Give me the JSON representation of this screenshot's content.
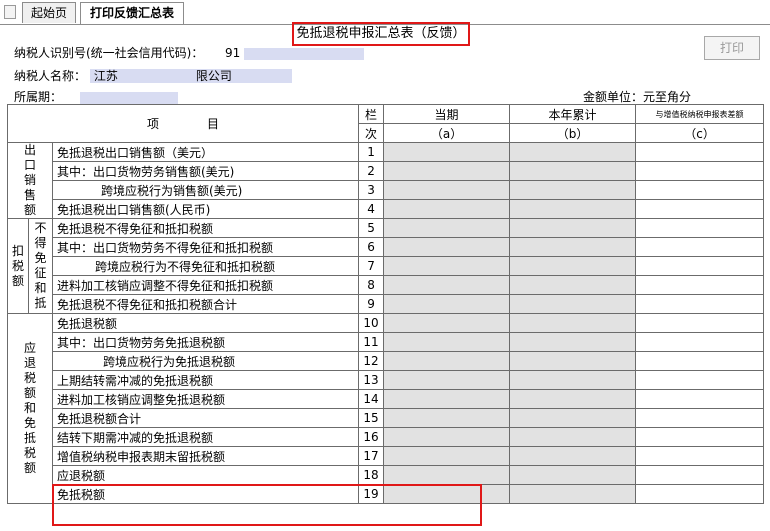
{
  "tabs": {
    "home": "起始页",
    "active": "打印反馈汇总表"
  },
  "report_title": "免抵退税申报汇总表（反馈）",
  "print_button": "打印",
  "taxpayer": {
    "id_label": "纳税人识别号(统一社会信用代码)：",
    "id_value": "91",
    "name_label": "纳税人名称：",
    "name_value": "江苏",
    "name_value_tail": "限公司",
    "period_label": "所属期："
  },
  "unit_label": "金额单位：元至角分",
  "header": {
    "item": "项　　　　目",
    "col_lan": "栏",
    "col_ci": "次",
    "current": "当期",
    "current_sub": "（a）",
    "cumulative": "本年累计",
    "cumulative_sub": "（b）",
    "diff": "与增值税纳税申报表差额",
    "diff_sub": "（c）"
  },
  "sections": {
    "s1": "出口销售额",
    "s2a": "扣税额",
    "s2b": "不得免征和抵",
    "s3": "应退税额和免抵税额"
  },
  "rows": [
    {
      "label": "免抵退税出口销售额（美元）",
      "num": "1"
    },
    {
      "label": "其中：出口货物劳务销售额(美元)",
      "num": "2"
    },
    {
      "label": "跨境应税行为销售额(美元)",
      "num": "3"
    },
    {
      "label": "免抵退税出口销售额(人民币)",
      "num": "4"
    },
    {
      "label": "免抵退税不得免征和抵扣税额",
      "num": "5"
    },
    {
      "label": "其中：出口货物劳务不得免征和抵扣税额",
      "num": "6"
    },
    {
      "label": "跨境应税行为不得免征和抵扣税额",
      "num": "7"
    },
    {
      "label": "进料加工核销应调整不得免征和抵扣税额",
      "num": "8"
    },
    {
      "label": "免抵退税不得免征和抵扣税额合计",
      "num": "9"
    },
    {
      "label": "免抵退税额",
      "num": "10"
    },
    {
      "label": "其中：出口货物劳务免抵退税额",
      "num": "11"
    },
    {
      "label": "跨境应税行为免抵退税额",
      "num": "12"
    },
    {
      "label": "上期结转需冲减的免抵退税额",
      "num": "13"
    },
    {
      "label": "进料加工核销应调整免抵退税额",
      "num": "14"
    },
    {
      "label": "免抵退税额合计",
      "num": "15"
    },
    {
      "label": "结转下期需冲减的免抵退税额",
      "num": "16"
    },
    {
      "label": "增值税纳税申报表期末留抵税额",
      "num": "17"
    },
    {
      "label": "应退税额",
      "num": "18"
    },
    {
      "label": "免抵税额",
      "num": "19"
    }
  ]
}
